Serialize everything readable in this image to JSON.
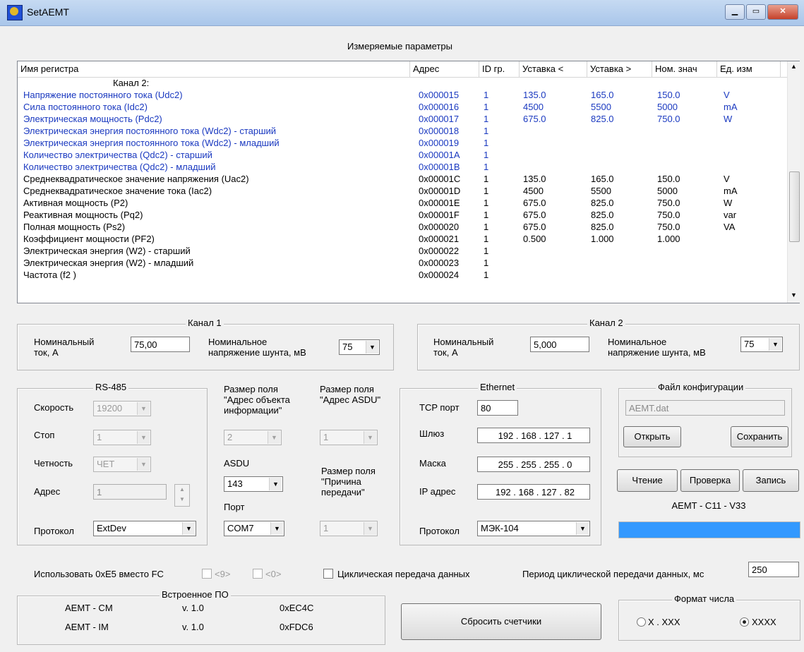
{
  "window": {
    "title": "SetAEMT",
    "min_icon": "minimize-icon",
    "max_icon": "maximize-icon",
    "close_icon": "close-icon"
  },
  "params": {
    "title": "Измеряемые параметры",
    "columns": [
      "Имя регистра",
      "Адрес",
      "ID гр.",
      "Уставка <",
      "Уставка >",
      "Ном. знач",
      "Ед. изм"
    ],
    "channel_header": "Канал 2:",
    "rows": [
      {
        "name": "Напряжение постоянного тока (Udc2)",
        "addr": "0x000015",
        "id": "1",
        "min": "135.0",
        "max": "165.0",
        "nom": "150.0",
        "unit": "V",
        "blue": true
      },
      {
        "name": "Сила постоянного тока (Idc2)",
        "addr": "0x000016",
        "id": "1",
        "min": "4500",
        "max": "5500",
        "nom": "5000",
        "unit": "mA",
        "blue": true
      },
      {
        "name": "Электрическая мощность (Pdc2)",
        "addr": "0x000017",
        "id": "1",
        "min": "675.0",
        "max": "825.0",
        "nom": "750.0",
        "unit": "W",
        "blue": true
      },
      {
        "name": "Электрическая энергия постоянного тока (Wdc2) - старший",
        "addr": "0x000018",
        "id": "1",
        "min": "",
        "max": "",
        "nom": "",
        "unit": "",
        "blue": true
      },
      {
        "name": "Электрическая энергия постоянного тока (Wdc2) - младший",
        "addr": "0x000019",
        "id": "1",
        "min": "",
        "max": "",
        "nom": "",
        "unit": "",
        "blue": true
      },
      {
        "name": "Количество электричества (Qdc2) - старший",
        "addr": "0x00001A",
        "id": "1",
        "min": "",
        "max": "",
        "nom": "",
        "unit": "",
        "blue": true
      },
      {
        "name": "Количество электричества (Qdc2) - младший",
        "addr": "0x00001B",
        "id": "1",
        "min": "",
        "max": "",
        "nom": "",
        "unit": "",
        "blue": true
      },
      {
        "name": "Среднеквадратическое значение напряжения (Uac2)",
        "addr": "0x00001C",
        "id": "1",
        "min": "135.0",
        "max": "165.0",
        "nom": "150.0",
        "unit": "V",
        "blue": false
      },
      {
        "name": "Среднеквадратическое значение тока (Iac2)",
        "addr": "0x00001D",
        "id": "1",
        "min": "4500",
        "max": "5500",
        "nom": "5000",
        "unit": "mA",
        "blue": false
      },
      {
        "name": "Активная мощность (P2)",
        "addr": "0x00001E",
        "id": "1",
        "min": "675.0",
        "max": "825.0",
        "nom": "750.0",
        "unit": "W",
        "blue": false
      },
      {
        "name": "Реактивная мощность (Pq2)",
        "addr": "0x00001F",
        "id": "1",
        "min": "675.0",
        "max": "825.0",
        "nom": "750.0",
        "unit": "var",
        "blue": false
      },
      {
        "name": "Полная мощность (Ps2)",
        "addr": "0x000020",
        "id": "1",
        "min": "675.0",
        "max": "825.0",
        "nom": "750.0",
        "unit": "VA",
        "blue": false
      },
      {
        "name": "Коэффициент мощности (PF2)",
        "addr": "0x000021",
        "id": "1",
        "min": "0.500",
        "max": "1.000",
        "nom": "1.000",
        "unit": "",
        "blue": false
      },
      {
        "name": "Электрическая энергия (W2) - старший",
        "addr": "0x000022",
        "id": "1",
        "min": "",
        "max": "",
        "nom": "",
        "unit": "",
        "blue": false
      },
      {
        "name": "Электрическая энергия (W2) - младший",
        "addr": "0x000023",
        "id": "1",
        "min": "",
        "max": "",
        "nom": "",
        "unit": "",
        "blue": false
      },
      {
        "name": "Частота (f2 )",
        "addr": "0x000024",
        "id": "1",
        "min": "",
        "max": "",
        "nom": "",
        "unit": "",
        "blue": false
      }
    ]
  },
  "channel1": {
    "title": "Канал 1",
    "current_label": "Номинальный\nток, А",
    "current_value": "75,00",
    "shunt_label": "Номинальное\nнапряжение шунта, мВ",
    "shunt_value": "75"
  },
  "channel2": {
    "title": "Канал 2",
    "current_label": "Номинальный\nток, А",
    "current_value": "5,000",
    "shunt_label": "Номинальное\nнапряжение шунта, мВ",
    "shunt_value": "75"
  },
  "rs485": {
    "title": "RS-485",
    "speed_label": "Скорость",
    "speed_value": "19200",
    "stop_label": "Стоп",
    "stop_value": "1",
    "parity_label": "Четность",
    "parity_value": "ЧЕТ",
    "address_label": "Адрес",
    "address_value": "1",
    "protocol_label": "Протокол",
    "protocol_value": "ExtDev"
  },
  "iec": {
    "ioa_label": "Размер поля\n\"Адрес объекта\nинформации\"",
    "ioa_value": "2",
    "asdu_size_label": "Размер поля\n\"Адрес ASDU\"",
    "asdu_size_value": "1",
    "asdu_label": "ASDU",
    "asdu_value": "143",
    "cause_label": "Размер поля\n\"Причина\nпередачи\"",
    "cause_value": "1",
    "port_label": "Порт",
    "port_value": "COM7"
  },
  "ethernet": {
    "title": "Ethernet",
    "tcp_label": "TCP порт",
    "tcp_value": "80",
    "gateway_label": "Шлюз",
    "gateway_value": "192 . 168 . 127 .  1",
    "mask_label": "Маска",
    "mask_value": "255 . 255 . 255 .  0",
    "ip_label": "IP адрес",
    "ip_value": "192 . 168 . 127 . 82",
    "protocol_label": "Протокол",
    "protocol_value": "МЭК-104"
  },
  "config": {
    "title": "Файл конфигурации",
    "file_value": "AEMT.dat",
    "open_label": "Открыть",
    "save_label": "Сохранить"
  },
  "actions": {
    "read_label": "Чтение",
    "check_label": "Проверка",
    "write_label": "Запись",
    "device_label": "AEMT - C11 - V33",
    "progress_fraction": 1.0,
    "progress_color": "#3399ff"
  },
  "options": {
    "use_e5_label": "Использовать 0xE5 вместо FC",
    "opt9_label": "<9>",
    "opt0_label": "<0>",
    "cyclic_label": "Циклическая передача данных",
    "period_label": "Период циклической передачи данных, мс",
    "period_value": "250"
  },
  "firmware": {
    "title": "Встроенное ПО",
    "rows": [
      {
        "name": "AEMT - CM",
        "ver": "v. 1.0",
        "crc": "0xEC4C"
      },
      {
        "name": "AEMT - IM",
        "ver": "v. 1.0",
        "crc": "0xFDC6"
      }
    ]
  },
  "reset_label": "Сбросить счетчики",
  "number_format": {
    "title": "Формат числа",
    "opt1": "X . XXX",
    "opt2": "XXXX",
    "selected": "XXXX"
  }
}
